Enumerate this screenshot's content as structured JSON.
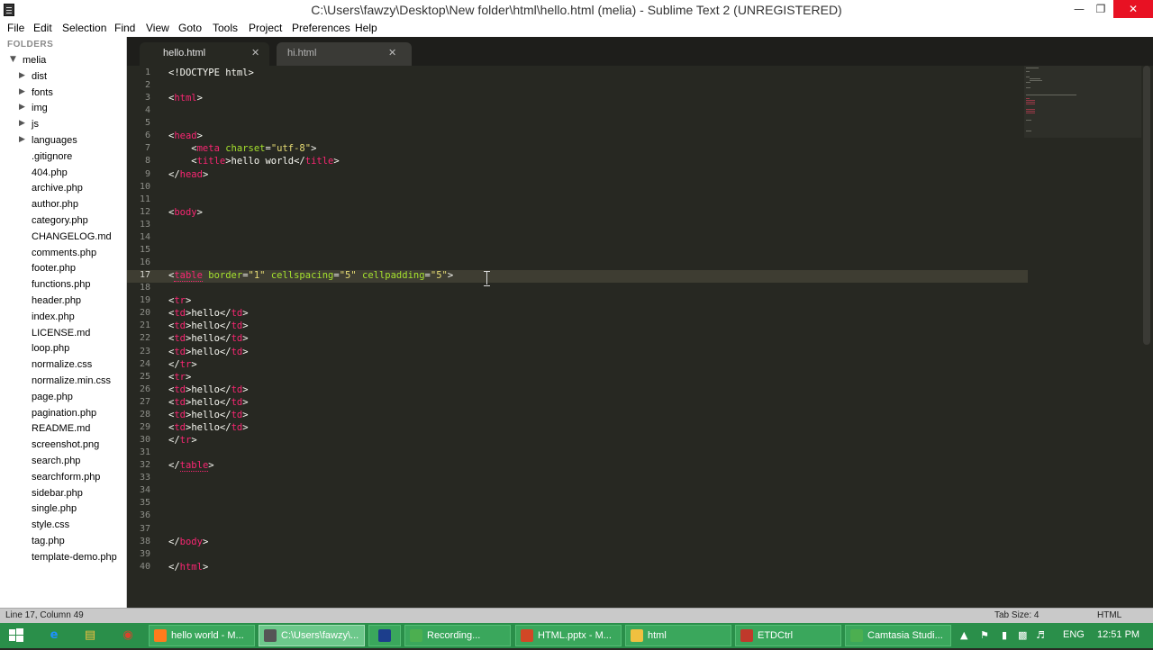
{
  "window": {
    "title": "C:\\Users\\fawzy\\Desktop\\New folder\\html\\hello.html (melia) - Sublime Text 2 (UNREGISTERED)",
    "minimize": "—",
    "maximize": "❐",
    "close": "✕"
  },
  "menu": [
    "File",
    "Edit",
    "Selection",
    "Find",
    "View",
    "Goto",
    "Tools",
    "Project",
    "Preferences",
    "Help"
  ],
  "sidebar": {
    "header": "FOLDERS",
    "root": "melia",
    "folders": [
      "dist",
      "fonts",
      "img",
      "js",
      "languages"
    ],
    "files": [
      ".gitignore",
      "404.php",
      "archive.php",
      "author.php",
      "category.php",
      "CHANGELOG.md",
      "comments.php",
      "footer.php",
      "functions.php",
      "header.php",
      "index.php",
      "LICENSE.md",
      "loop.php",
      "normalize.css",
      "normalize.min.css",
      "page.php",
      "pagination.php",
      "README.md",
      "screenshot.png",
      "search.php",
      "searchform.php",
      "sidebar.php",
      "single.php",
      "style.css",
      "tag.php",
      "template-demo.php"
    ]
  },
  "tabs": [
    {
      "label": "hello.html",
      "close": "✕",
      "active": true
    },
    {
      "label": "hi.html",
      "close": "✕",
      "active": false
    }
  ],
  "editor": {
    "current_line": 17,
    "lines": [
      {
        "n": 1,
        "tokens": [
          [
            "c-text",
            "<!DOCTYPE html>"
          ]
        ]
      },
      {
        "n": 2,
        "tokens": []
      },
      {
        "n": 3,
        "tokens": [
          [
            "c-punct",
            "<"
          ],
          [
            "c-tag",
            "html"
          ],
          [
            "c-punct",
            ">"
          ]
        ]
      },
      {
        "n": 4,
        "tokens": []
      },
      {
        "n": 5,
        "tokens": []
      },
      {
        "n": 6,
        "tokens": [
          [
            "c-punct",
            "<"
          ],
          [
            "c-tag",
            "head"
          ],
          [
            "c-punct",
            ">"
          ]
        ]
      },
      {
        "n": 7,
        "tokens": [
          [
            "c-punct",
            "    <"
          ],
          [
            "c-tag",
            "meta"
          ],
          [
            "c-punct",
            " "
          ],
          [
            "c-attr",
            "charset"
          ],
          [
            "c-punct",
            "="
          ],
          [
            "c-str",
            "\"utf-8\""
          ],
          [
            "c-punct",
            ">"
          ]
        ]
      },
      {
        "n": 8,
        "tokens": [
          [
            "c-punct",
            "    <"
          ],
          [
            "c-tag",
            "title"
          ],
          [
            "c-punct",
            ">"
          ],
          [
            "c-text",
            "hello world"
          ],
          [
            "c-punct",
            "</"
          ],
          [
            "c-tag",
            "title"
          ],
          [
            "c-punct",
            ">"
          ]
        ]
      },
      {
        "n": 9,
        "tokens": [
          [
            "c-punct",
            "</"
          ],
          [
            "c-tag",
            "head"
          ],
          [
            "c-punct",
            ">"
          ]
        ]
      },
      {
        "n": 10,
        "tokens": []
      },
      {
        "n": 11,
        "tokens": []
      },
      {
        "n": 12,
        "tokens": [
          [
            "c-punct",
            "<"
          ],
          [
            "c-tag",
            "body"
          ],
          [
            "c-punct",
            ">"
          ]
        ]
      },
      {
        "n": 13,
        "tokens": []
      },
      {
        "n": 14,
        "tokens": []
      },
      {
        "n": 15,
        "tokens": []
      },
      {
        "n": 16,
        "tokens": []
      },
      {
        "n": 17,
        "tokens": [
          [
            "c-punct",
            "<"
          ],
          [
            "c-tag squiggle",
            "table"
          ],
          [
            "c-punct",
            " "
          ],
          [
            "c-attr",
            "border"
          ],
          [
            "c-punct",
            "="
          ],
          [
            "c-str",
            "\"1\""
          ],
          [
            "c-punct",
            " "
          ],
          [
            "c-attr",
            "cellspacing"
          ],
          [
            "c-punct",
            "="
          ],
          [
            "c-str",
            "\"5\""
          ],
          [
            "c-punct",
            " "
          ],
          [
            "c-attr",
            "cellpadding"
          ],
          [
            "c-punct",
            "="
          ],
          [
            "c-str",
            "\"5\""
          ],
          [
            "c-punct",
            ">"
          ]
        ]
      },
      {
        "n": 18,
        "tokens": []
      },
      {
        "n": 19,
        "tokens": [
          [
            "c-punct",
            "<"
          ],
          [
            "c-tag",
            "tr"
          ],
          [
            "c-punct",
            ">"
          ]
        ]
      },
      {
        "n": 20,
        "tokens": [
          [
            "c-punct",
            "<"
          ],
          [
            "c-tag",
            "td"
          ],
          [
            "c-punct",
            ">"
          ],
          [
            "c-text",
            "hello"
          ],
          [
            "c-punct",
            "</"
          ],
          [
            "c-tag",
            "td"
          ],
          [
            "c-punct",
            ">"
          ]
        ]
      },
      {
        "n": 21,
        "tokens": [
          [
            "c-punct",
            "<"
          ],
          [
            "c-tag",
            "td"
          ],
          [
            "c-punct",
            ">"
          ],
          [
            "c-text",
            "hello"
          ],
          [
            "c-punct",
            "</"
          ],
          [
            "c-tag",
            "td"
          ],
          [
            "c-punct",
            ">"
          ]
        ]
      },
      {
        "n": 22,
        "tokens": [
          [
            "c-punct",
            "<"
          ],
          [
            "c-tag",
            "td"
          ],
          [
            "c-punct",
            ">"
          ],
          [
            "c-text",
            "hello"
          ],
          [
            "c-punct",
            "</"
          ],
          [
            "c-tag",
            "td"
          ],
          [
            "c-punct",
            ">"
          ]
        ]
      },
      {
        "n": 23,
        "tokens": [
          [
            "c-punct",
            "<"
          ],
          [
            "c-tag",
            "td"
          ],
          [
            "c-punct",
            ">"
          ],
          [
            "c-text",
            "hello"
          ],
          [
            "c-punct",
            "</"
          ],
          [
            "c-tag",
            "td"
          ],
          [
            "c-punct",
            ">"
          ]
        ]
      },
      {
        "n": 24,
        "tokens": [
          [
            "c-punct",
            "</"
          ],
          [
            "c-tag",
            "tr"
          ],
          [
            "c-punct",
            ">"
          ]
        ]
      },
      {
        "n": 25,
        "tokens": [
          [
            "c-punct",
            "<"
          ],
          [
            "c-tag",
            "tr"
          ],
          [
            "c-punct",
            ">"
          ]
        ]
      },
      {
        "n": 26,
        "tokens": [
          [
            "c-punct",
            "<"
          ],
          [
            "c-tag",
            "td"
          ],
          [
            "c-punct",
            ">"
          ],
          [
            "c-text",
            "hello"
          ],
          [
            "c-punct",
            "</"
          ],
          [
            "c-tag",
            "td"
          ],
          [
            "c-punct",
            ">"
          ]
        ]
      },
      {
        "n": 27,
        "tokens": [
          [
            "c-punct",
            "<"
          ],
          [
            "c-tag",
            "td"
          ],
          [
            "c-punct",
            ">"
          ],
          [
            "c-text",
            "hello"
          ],
          [
            "c-punct",
            "</"
          ],
          [
            "c-tag",
            "td"
          ],
          [
            "c-punct",
            ">"
          ]
        ]
      },
      {
        "n": 28,
        "tokens": [
          [
            "c-punct",
            "<"
          ],
          [
            "c-tag",
            "td"
          ],
          [
            "c-punct",
            ">"
          ],
          [
            "c-text",
            "hello"
          ],
          [
            "c-punct",
            "</"
          ],
          [
            "c-tag",
            "td"
          ],
          [
            "c-punct",
            ">"
          ]
        ]
      },
      {
        "n": 29,
        "tokens": [
          [
            "c-punct",
            "<"
          ],
          [
            "c-tag",
            "td"
          ],
          [
            "c-punct",
            ">"
          ],
          [
            "c-text",
            "hello"
          ],
          [
            "c-punct",
            "</"
          ],
          [
            "c-tag",
            "td"
          ],
          [
            "c-punct",
            ">"
          ]
        ]
      },
      {
        "n": 30,
        "tokens": [
          [
            "c-punct",
            "</"
          ],
          [
            "c-tag",
            "tr"
          ],
          [
            "c-punct",
            ">"
          ]
        ]
      },
      {
        "n": 31,
        "tokens": []
      },
      {
        "n": 32,
        "tokens": [
          [
            "c-punct",
            "</"
          ],
          [
            "c-tag squiggle",
            "table"
          ],
          [
            "c-punct",
            ">"
          ]
        ]
      },
      {
        "n": 33,
        "tokens": []
      },
      {
        "n": 34,
        "tokens": []
      },
      {
        "n": 35,
        "tokens": []
      },
      {
        "n": 36,
        "tokens": []
      },
      {
        "n": 37,
        "tokens": []
      },
      {
        "n": 38,
        "tokens": [
          [
            "c-punct",
            "</"
          ],
          [
            "c-tag",
            "body"
          ],
          [
            "c-punct",
            ">"
          ]
        ]
      },
      {
        "n": 39,
        "tokens": []
      },
      {
        "n": 40,
        "tokens": [
          [
            "c-punct",
            "</"
          ],
          [
            "c-tag",
            "html"
          ],
          [
            "c-punct",
            ">"
          ]
        ]
      }
    ]
  },
  "status": {
    "position": "Line 17, Column 49",
    "tab_size": "Tab Size: 4",
    "syntax": "HTML"
  },
  "taskbar": {
    "start_icon": "windows-logo-icon",
    "pinned": [
      {
        "name": "internet-explorer-icon",
        "glyph": "e",
        "color": "#1e90ff"
      },
      {
        "name": "file-explorer-icon",
        "glyph": "▤",
        "color": "#f0c040"
      },
      {
        "name": "chrome-icon",
        "glyph": "◉",
        "color": "#d9442c"
      }
    ],
    "tasks": [
      {
        "label": "hello world - M...",
        "color": "#ff7b1c",
        "active": false
      },
      {
        "label": "C:\\Users\\fawzy\\...",
        "color": "#555555",
        "active": true
      },
      {
        "label": "",
        "color": "#1c3e8c",
        "active": false,
        "icon_only": true
      },
      {
        "label": "Recording...",
        "color": "#4caf50",
        "active": false
      },
      {
        "label": "HTML.pptx - M...",
        "color": "#d24726",
        "active": false
      },
      {
        "label": "html",
        "color": "#f0c040",
        "active": false
      },
      {
        "label": "ETDCtrl",
        "color": "#c0392b",
        "active": false
      },
      {
        "label": "Camtasia Studi...",
        "color": "#4caf50",
        "active": false
      }
    ],
    "tray": {
      "lang": "ENG",
      "time": "12:51 PM"
    }
  }
}
